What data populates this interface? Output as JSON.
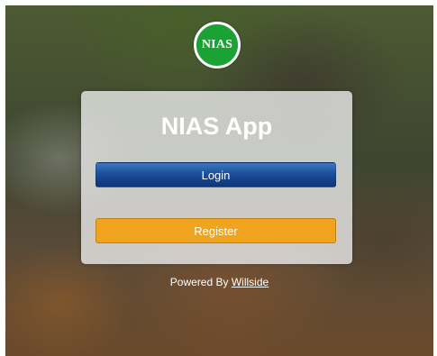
{
  "logo": {
    "text": "NIAS",
    "color": "#1aa234"
  },
  "card": {
    "title": "NIAS App"
  },
  "buttons": {
    "login": {
      "label": "Login",
      "color": "#1d4f9a"
    },
    "register": {
      "label": "Register",
      "color": "#f0a31c"
    }
  },
  "footer": {
    "prefix": "Powered By",
    "link_text": "Willside"
  }
}
